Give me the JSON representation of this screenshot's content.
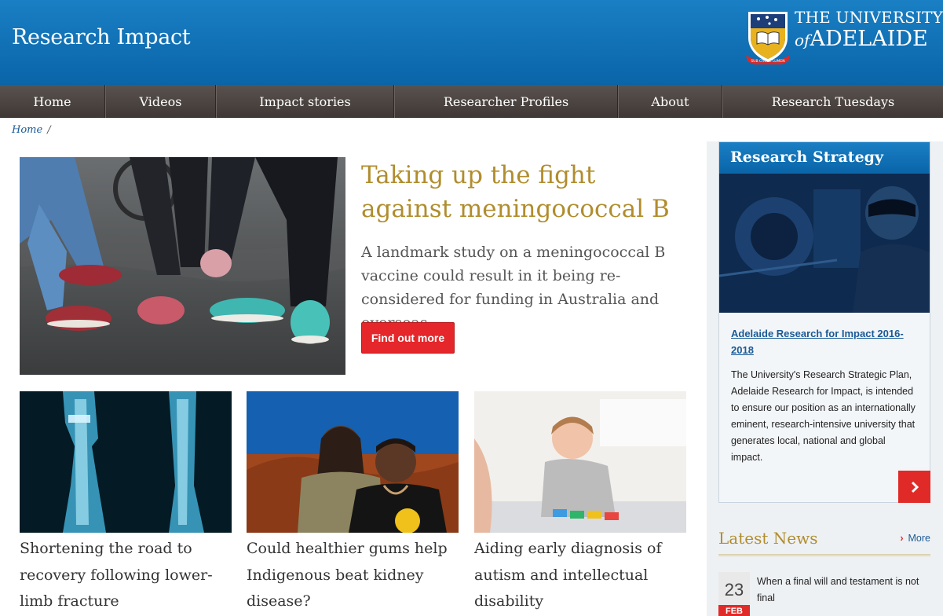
{
  "header": {
    "site_title": "Research Impact",
    "university_line1": "THE UNIVERSITY",
    "university_of": "of",
    "university_line2": "ADELAIDE",
    "crest_motto": "SUB CRUCE LUMEN"
  },
  "nav": {
    "items": [
      {
        "label": "Home"
      },
      {
        "label": "Videos"
      },
      {
        "label": "Impact stories"
      },
      {
        "label": "Researcher Profiles"
      },
      {
        "label": "About"
      },
      {
        "label": "Research Tuesdays"
      }
    ]
  },
  "breadcrumb": {
    "home": "Home",
    "separator": "/"
  },
  "feature": {
    "title": "Taking up the fight against meningococcal B",
    "description": "A landmark study on a meningococcal B vaccine could result in it being re-considered for funding in Australia and overseas.",
    "button_label": "Find out more"
  },
  "cards": [
    {
      "title": "Shortening the road to recovery following lower-limb fracture"
    },
    {
      "title": "Could healthier gums help Indigenous beat kidney disease?"
    },
    {
      "title": "Aiding early diagnosis of autism and intellectual disability"
    }
  ],
  "sidebar": {
    "strategy": {
      "heading": "Research Strategy",
      "link_text": "Adelaide Research for Impact 2016-2018",
      "body": "The University's Research Strategic Plan, Adelaide Research for Impact, is intended to ensure our position as an internationally eminent, research-intensive university that generates local, national and global impact."
    },
    "news": {
      "heading": "Latest News",
      "more_label": "More",
      "items": [
        {
          "day": "23",
          "month": "FEB",
          "text": "When a final will and testament is not final"
        }
      ]
    }
  },
  "colors": {
    "header_blue": "#0a64a8",
    "nav_brown": "#4a4340",
    "gold": "#b08d2d",
    "accent_red": "#e5262a",
    "link_blue": "#1a5a96"
  },
  "icons": {
    "more_chevron": "chevron-right-icon",
    "strategy_arrow": "arrow-right-icon",
    "crest": "university-crest-icon"
  }
}
